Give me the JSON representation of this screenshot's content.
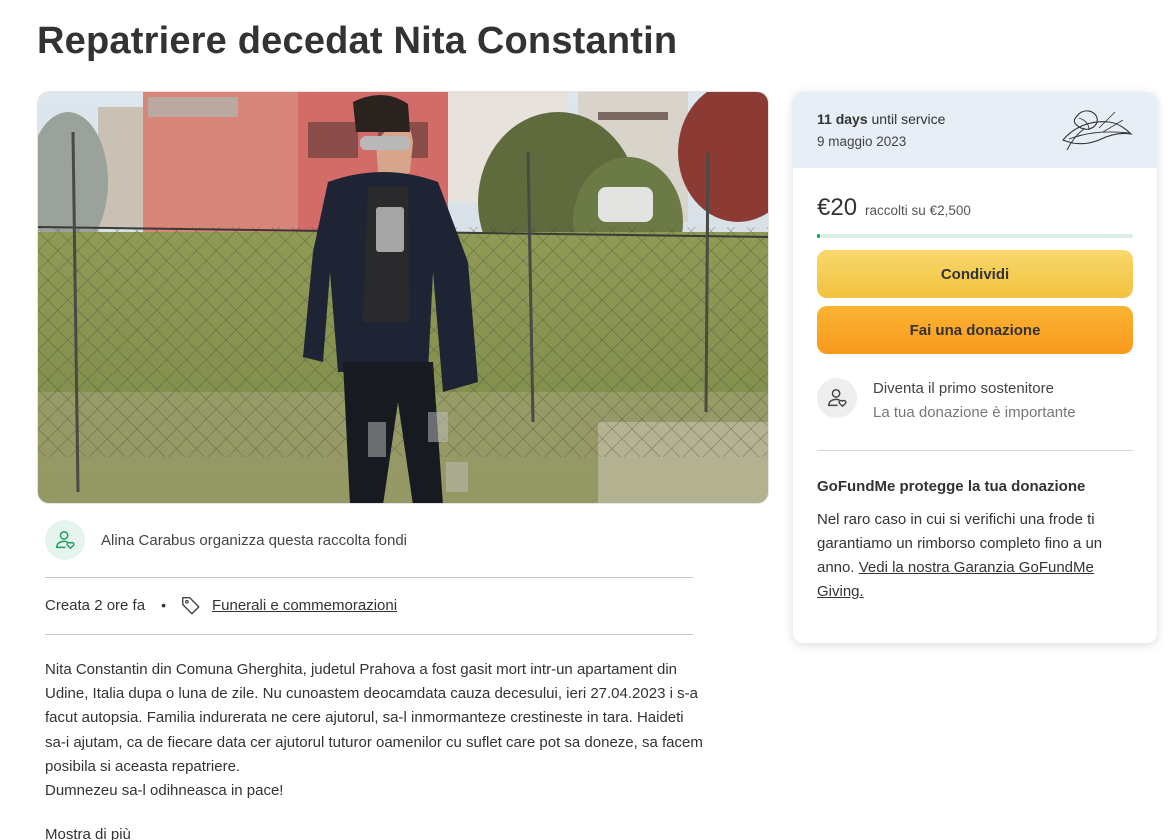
{
  "campaign": {
    "title": "Repatriere decedat Nita Constantin"
  },
  "organizer": {
    "text": "Alina Carabus organizza questa raccolta fondi",
    "icon": "person-heart-icon"
  },
  "meta": {
    "created": "Creata 2 ore fa",
    "separator": "•",
    "category": "Funerali e commemorazioni",
    "category_icon": "tag-icon"
  },
  "story": {
    "text": "Nita Constantin din Comuna Gherghita, judetul Prahova a fost gasit mort intr-un apartament din Udine, Italia dupa o luna de zile. Nu cunoastem deocamdata cauza decesului, ieri 27.04.2023 i s-a facut autopsia. Familia indurerata ne cere ajutorul, sa-l inmormanteze crestineste in tara. Haideti sa-i ajutam, ca de fiecare data cer ajutorul tuturor oamenilor cu suflet care pot sa doneze, sa facem posibila si aceasta repatriere.\nDumnezeu sa-l odihneasca in pace!",
    "show_more": "Mostra di più"
  },
  "card": {
    "days_count": "11 days",
    "days_label": "until service",
    "service_date": "9 maggio 2023",
    "leaf_icon": "lily-leaf-icon",
    "raised": "€20",
    "raised_label": "raccolti su €2,500",
    "progress_fraction": 0.008,
    "share_button": "Condividi",
    "donate_button": "Fai una donazione",
    "first_supporter": "Diventa il primo sostenitore",
    "first_supporter_sub": "La tua donazione è importante",
    "protect_title": "GoFundMe protegge la tua donazione",
    "protect_text": "Nel raro caso in cui si verifichi una frode ti garantiamo un rimborso completo fino a un anno.",
    "protect_link": "Vedi la nostra Garanzia GoFundMe Giving."
  },
  "colors": {
    "progress_fill": "#02a95c",
    "header_bg": "#e7eef6",
    "share_btn": "#f5c94f",
    "donate_btn": "#fba42a"
  }
}
